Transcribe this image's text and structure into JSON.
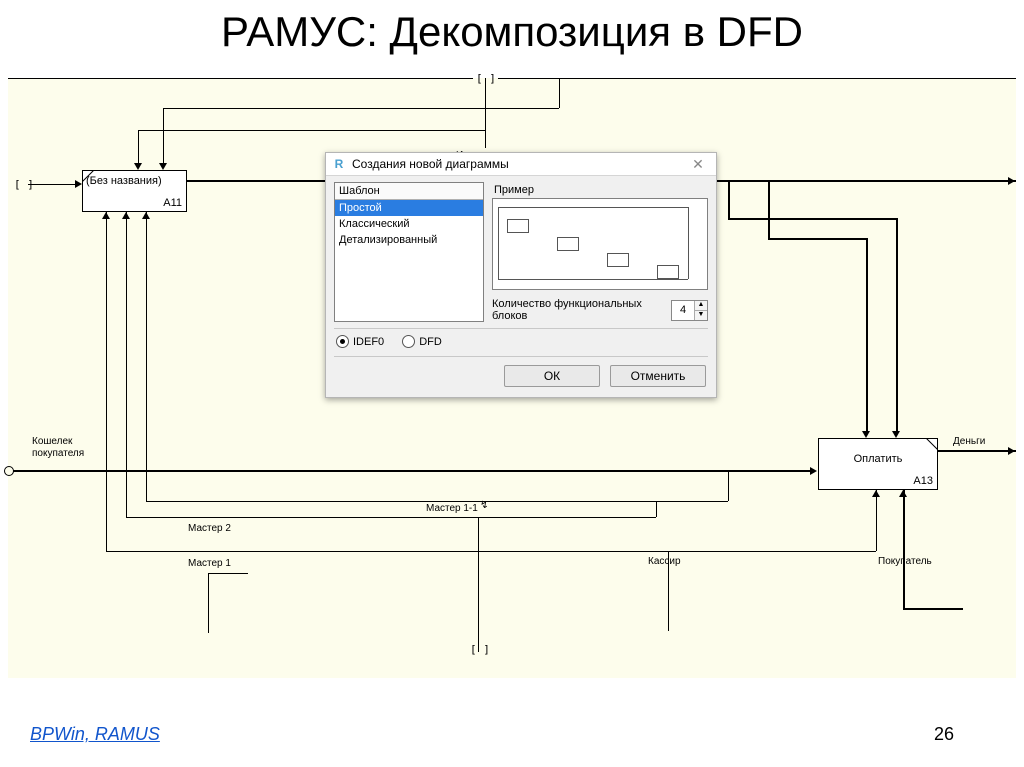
{
  "slide": {
    "title": "РАМУС: Декомпозиция в DFD",
    "footer_link": "BPWin, RAMUS",
    "page_number": "26"
  },
  "diagram": {
    "box_a11": {
      "title": "(Без названия)",
      "id": "A11"
    },
    "box_a13": {
      "title": "Оплатить",
      "id": "A13"
    },
    "labels": {
      "instruction": "Инструкция",
      "wallet_line1": "Кошелек",
      "wallet_line2": "покупателя",
      "master2": "Мастер 2",
      "master1": "Мастер 1",
      "master11": "Мастер 1-1",
      "cashier": "Кассир",
      "buyer": "Покупатель",
      "money": "Деньги"
    },
    "brackets": {
      "left": "[ ]",
      "top": "[ ]",
      "bottom": "[ ]"
    }
  },
  "dialog": {
    "title": "Создания новой диаграммы",
    "template_header": "Шаблон",
    "template_items": [
      "Простой",
      "Классический",
      "Детализированный"
    ],
    "template_selected_index": 0,
    "example_header": "Пример",
    "blocks_label": "Количество функциональных блоков",
    "blocks_value": "4",
    "notations": {
      "idef0": "IDEF0",
      "dfd": "DFD",
      "selected": "idef0"
    },
    "buttons": {
      "ok": "ОК",
      "cancel": "Отменить"
    }
  }
}
